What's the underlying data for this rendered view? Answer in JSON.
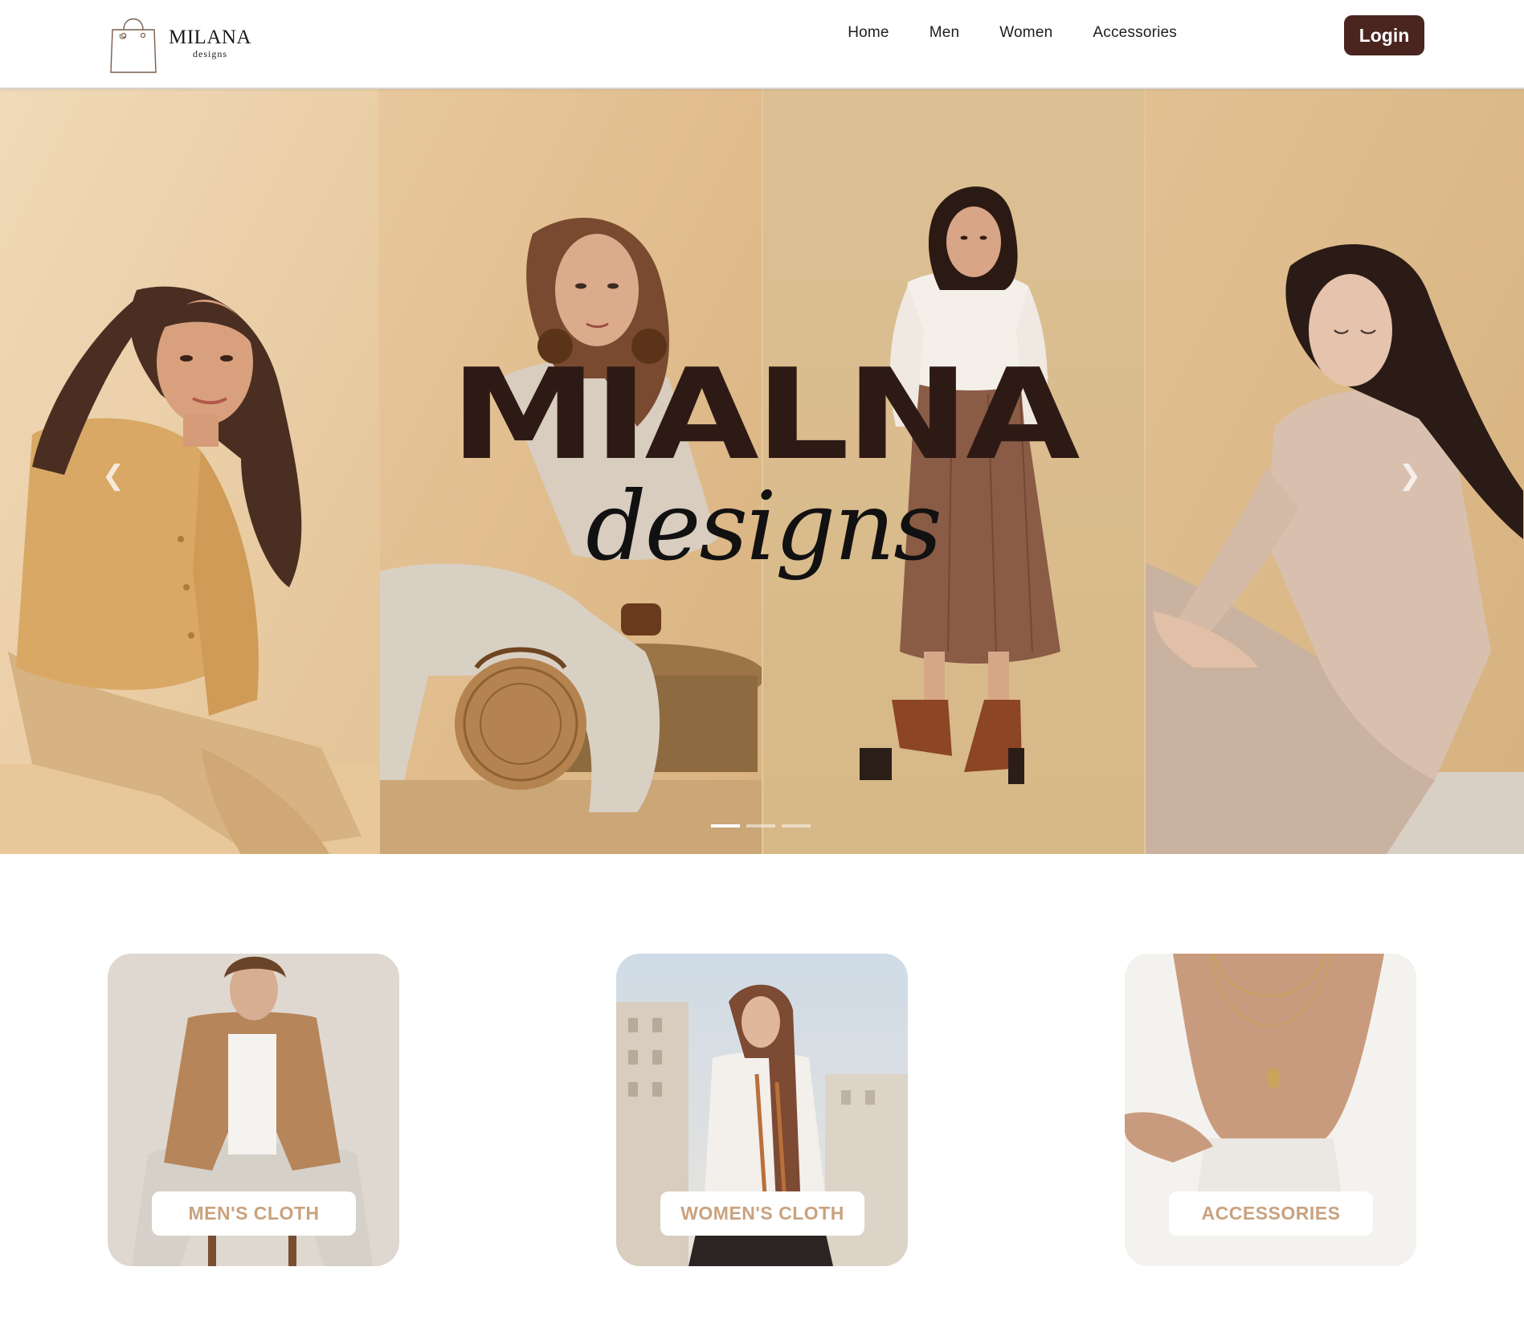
{
  "brand": {
    "name": "MILANA",
    "tagline": "designs"
  },
  "nav": {
    "items": [
      "Home",
      "Men",
      "Women",
      "Accessories"
    ],
    "login_label": "Login"
  },
  "hero": {
    "title": "MIALNA",
    "subtitle": "designs",
    "prev_icon": "chevron-left-icon",
    "next_icon": "chevron-right-icon",
    "slides_count": 3,
    "active_slide": 1
  },
  "categories": [
    {
      "label": "MEN'S CLOTH"
    },
    {
      "label": "WOMEN'S CLOTH"
    },
    {
      "label": "ACCESSORIES"
    }
  ],
  "colors": {
    "accent": "#4a2520",
    "hero_title": "#2e1a15",
    "card_label": "#c9a27f",
    "hero_bg": "#e6c79c"
  }
}
